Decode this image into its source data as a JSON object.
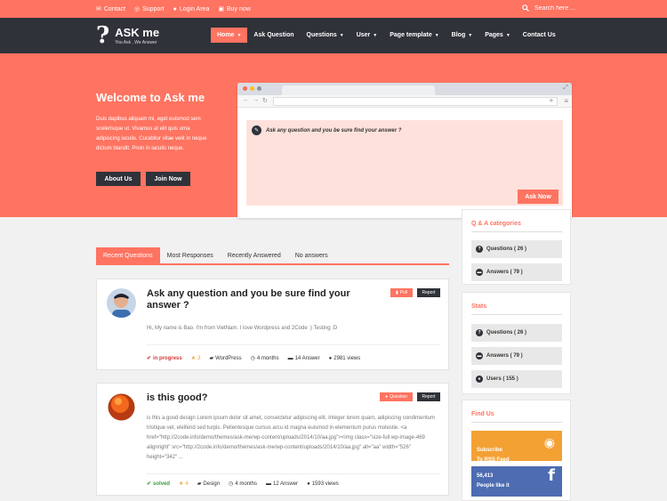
{
  "topbar": {
    "links": [
      {
        "icon": "mail-icon",
        "label": "Contact"
      },
      {
        "icon": "life-ring-icon",
        "label": "Support"
      },
      {
        "icon": "user-icon",
        "label": "Login Area"
      },
      {
        "icon": "cart-icon",
        "label": "Buy now"
      }
    ],
    "search_placeholder": "Search here ..."
  },
  "nav": {
    "logo_name": "ASK me",
    "logo_tagline": "You Ask , We Answer",
    "menu": [
      {
        "label": "Home",
        "dropdown": true,
        "active": true
      },
      {
        "label": "Ask Question",
        "dropdown": false
      },
      {
        "label": "Questions",
        "dropdown": true
      },
      {
        "label": "User",
        "dropdown": true
      },
      {
        "label": "Page template",
        "dropdown": true
      },
      {
        "label": "Blog",
        "dropdown": true
      },
      {
        "label": "Pages",
        "dropdown": true
      },
      {
        "label": "Contact Us",
        "dropdown": false
      }
    ]
  },
  "hero": {
    "title": "Welcome to Ask me",
    "text": "Duis dapibus aliquam mi, eget euismod sem scelerisque ut. Vivamus at elit quis urna adipiscing iaculis. Curabitur vitae velit in neque dictum blandit. Proin in iaculis neque.",
    "about_button": "About Us",
    "join_button": "Join Now",
    "ask_placeholder": "Ask any question and you be sure find your answer ?",
    "ask_button": "Ask Now"
  },
  "tabs": [
    "Recent Questions",
    "Most Responses",
    "Recently Answered",
    "No answers"
  ],
  "questions": [
    {
      "title": "Ask any question and you be sure find your answer ?",
      "badge": "Poll",
      "report": "Report",
      "excerpt": "Hi, My name is Bao. I'm from VietNam. I love Wordpress and 2Code :) Testing :D",
      "status": "in progress",
      "rating": "3",
      "category": "WordPress",
      "time": "4 months",
      "answers": "14 Answer",
      "views": "2981 views"
    },
    {
      "title": "is this good?",
      "badge": "Question",
      "report": "Report",
      "excerpt": "is this a good design Lorem ipsum dolor sit amet, consectetur adipiscing elit. Integer lorem quam, adipiscing condimentum tristique vel, eleifend sed turpis. Pellentesque cursus arcu id magna euismod in elementum purus molestie. <a href=\"http://2code.info/demo/themes/ask-me/wp-content/uploads/2014/10/aa.jpg\"><img class=\"size-full wp-image-469 alignright\" src=\"http://2code.info/demo/themes/ask-me/wp-content/uploads/2014/10/aa.jpg\" alt=\"aa\" width=\"526\" height=\"342\" ...",
      "status": "solved",
      "rating": "4",
      "category": "Design",
      "time": "4 months",
      "answers": "12 Answer",
      "views": "1593 views"
    }
  ],
  "sidebar": {
    "categories_title": "Q & A categories",
    "categories": [
      "Questions ( 26 )",
      "Answers ( 79 )"
    ],
    "stats_title": "Stats",
    "stats": [
      "Questions ( 26 )",
      "Answers ( 79 )",
      "Users ( 155 )"
    ],
    "find_title": "Find Us",
    "rss_label": "Subscribe\nTo RSS Feed",
    "fb_count": "56,413",
    "fb_label": "People like it"
  },
  "colors": {
    "accent": "#ff7361",
    "dark": "#2f3239",
    "rss": "#f4a134",
    "facebook": "#4d6cb2"
  }
}
